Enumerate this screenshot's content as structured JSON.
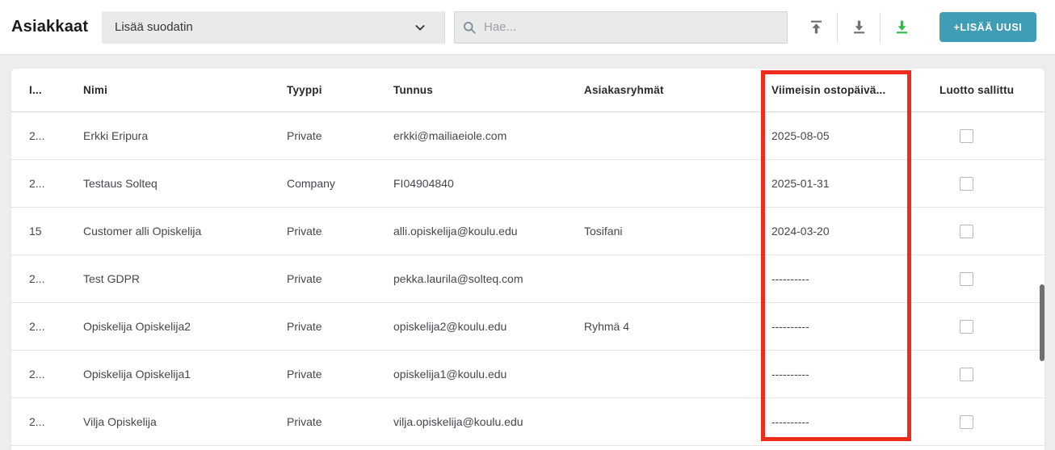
{
  "page": {
    "title": "Asiakkaat"
  },
  "toolbar": {
    "filter_dropdown": {
      "label": "Lisää suodatin"
    },
    "search": {
      "placeholder": "Hae...",
      "value": ""
    },
    "icons": [
      {
        "name": "upload-icon",
        "color": "#6f6f6f"
      },
      {
        "name": "download-icon",
        "color": "#6f6f6f"
      },
      {
        "name": "export-download-icon",
        "color": "#2fbc49"
      }
    ],
    "add_button_label": "+LISÄÄ UUSI"
  },
  "table": {
    "columns": {
      "id": "I...",
      "name": "Nimi",
      "type": "Tyyppi",
      "code": "Tunnus",
      "groups": "Asiakasryhmät",
      "last_purchase": "Viimeisin ostopäivä...",
      "credit": "Luotto sallittu"
    },
    "rows": [
      {
        "id": "2...",
        "name": "Erkki Eripura",
        "type": "Private",
        "code": "erkki@mailiaeiole.com",
        "groups": "",
        "last_purchase": "2025-08-05",
        "credit_allowed": false
      },
      {
        "id": "2...",
        "name": "Testaus Solteq",
        "type": "Company",
        "code": "FI04904840",
        "groups": "",
        "last_purchase": "2025-01-31",
        "credit_allowed": false
      },
      {
        "id": "15",
        "name": "Customer alli Opiskelija",
        "type": "Private",
        "code": "alli.opiskelija@koulu.edu",
        "groups": "Tosifani",
        "last_purchase": "2024-03-20",
        "credit_allowed": false
      },
      {
        "id": "2...",
        "name": "Test GDPR",
        "type": "Private",
        "code": "pekka.laurila@solteq.com",
        "groups": "",
        "last_purchase": "----------",
        "credit_allowed": false
      },
      {
        "id": "2...",
        "name": "Opiskelija Opiskelija2",
        "type": "Private",
        "code": "opiskelija2@koulu.edu",
        "groups": "Ryhmä 4",
        "last_purchase": "----------",
        "credit_allowed": false
      },
      {
        "id": "2...",
        "name": "Opiskelija Opiskelija1",
        "type": "Private",
        "code": "opiskelija1@koulu.edu",
        "groups": "",
        "last_purchase": "----------",
        "credit_allowed": false
      },
      {
        "id": "2...",
        "name": "Vilja Opiskelija",
        "type": "Private",
        "code": "vilja.opiskelija@koulu.edu",
        "groups": "",
        "last_purchase": "----------",
        "credit_allowed": false
      }
    ]
  },
  "annotation": {
    "highlighted_column": "Viimeisin ostopäivä...",
    "highlight_color": "#ee2c1c"
  },
  "colors": {
    "accent_teal": "#3f9eb5",
    "accent_green": "#2fbc49",
    "icon_gray": "#6f6f6f",
    "page_background": "#ededee"
  }
}
